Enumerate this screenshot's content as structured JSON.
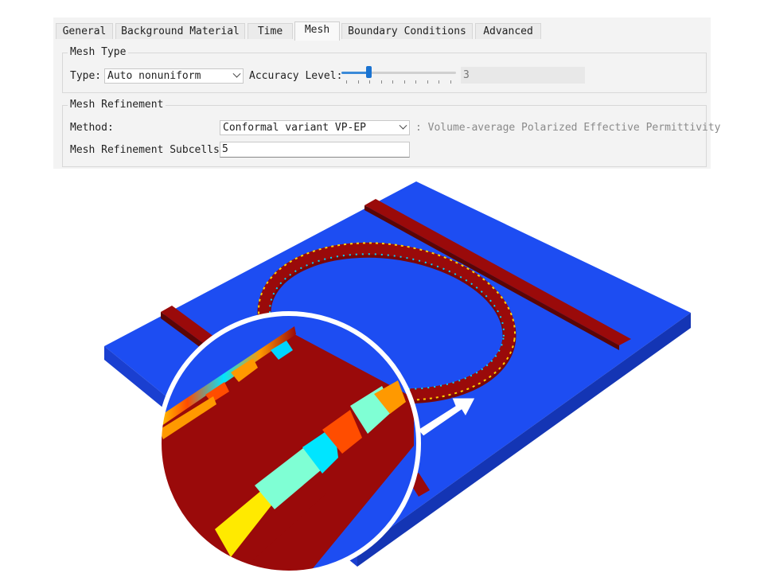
{
  "tabs": [
    "General",
    "Background Material",
    "Time",
    "Mesh",
    "Boundary Conditions",
    "Advanced"
  ],
  "active_tab": "Mesh",
  "mesh_type": {
    "title": "Mesh Type",
    "type_label": "Type:",
    "type_value": "Auto nonuniform",
    "accuracy_label": "Accuracy Level:",
    "accuracy_value": "3"
  },
  "mesh_refinement": {
    "title": "Mesh Refinement",
    "method_label": "Method:",
    "method_value": "Conformal variant VP-EP",
    "method_hint": ": Volume-average Polarized Effective Permittivity",
    "subcells_label": "Mesh Refinement Subcells:",
    "subcells_value": "5"
  },
  "colors": {
    "substrate": "#1d4df2",
    "waveguide": "#9a0a0a",
    "panel_bg": "#f3f3f3",
    "slider_accent": "#1a73d1"
  }
}
